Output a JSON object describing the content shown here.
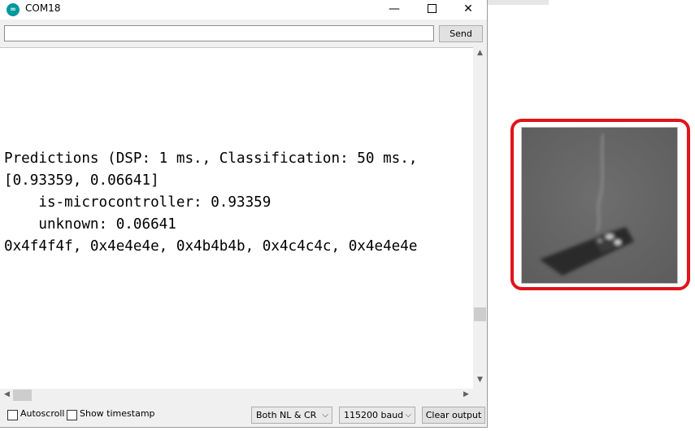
{
  "window": {
    "title": "COM18",
    "minimize_glyph": "—",
    "close_glyph": "✕"
  },
  "send_bar": {
    "input_value": "",
    "send_label": "Send"
  },
  "output": {
    "lines": [
      "Predictions (DSP: 1 ms., Classification: 50 ms.,",
      "[0.93359, 0.06641]",
      "    is-microcontroller: 0.93359",
      "    unknown: 0.06641",
      "0x4f4f4f, 0x4e4e4e, 0x4b4b4b, 0x4c4c4c, 0x4e4e4e"
    ]
  },
  "footer": {
    "autoscroll_label": "Autoscroll",
    "autoscroll_checked": false,
    "timestamp_label": "Show timestamp",
    "timestamp_checked": false,
    "line_ending": "Both NL & CR",
    "baud_rate": "115200 baud",
    "clear_label": "Clear output"
  },
  "captured_image": {
    "icon": "microcontroller-photo",
    "highlight_color": "#e0141a"
  }
}
